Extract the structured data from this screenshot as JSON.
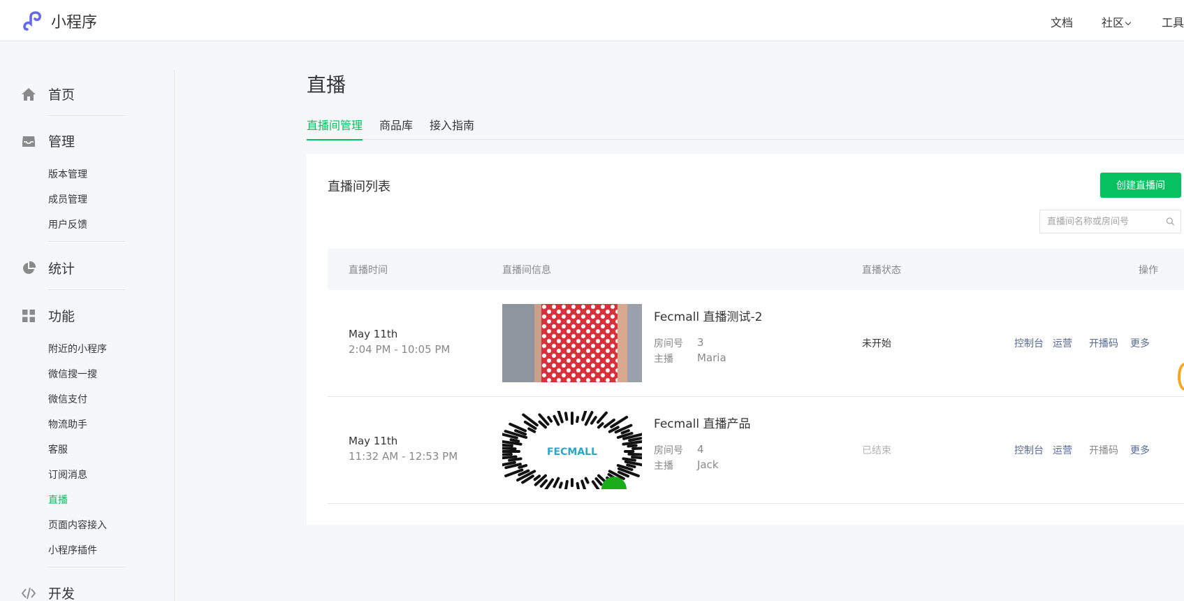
{
  "header": {
    "brand": "小程序",
    "nav": {
      "docs": "文档",
      "community": "社区",
      "tools": "工具"
    }
  },
  "sidebar": {
    "groups": {
      "home": "首页",
      "manage": "管理",
      "stats": "统计",
      "features": "功能",
      "dev": "开发"
    },
    "manage_items": [
      "版本管理",
      "成员管理",
      "用户反馈"
    ],
    "feature_items": [
      "附近的小程序",
      "微信搜一搜",
      "微信支付",
      "物流助手",
      "客服",
      "订阅消息",
      "直播",
      "页面内容接入",
      "小程序插件"
    ],
    "active_item": "直播"
  },
  "page": {
    "title": "直播",
    "tabs": [
      "直播间管理",
      "商品库",
      "接入指南"
    ],
    "active_tab": "直播间管理"
  },
  "panel": {
    "title": "直播间列表",
    "create_button": "创建直播间",
    "search_placeholder": "直播间名称或房间号",
    "columns": {
      "time": "直播时间",
      "info": "直播间信息",
      "status": "直播状态",
      "actions": "操作"
    },
    "meta_labels": {
      "room_no": "房间号",
      "anchor": "主播"
    },
    "rows": [
      {
        "date": "May 11th",
        "time_range": "2:04 PM - 10:05 PM",
        "name": "Fecmall 直播测试-2",
        "room_no": "3",
        "anchor": "Maria",
        "status": "未开始",
        "status_color": "#353535",
        "thumb": "red-polka-dot-dress-image",
        "actions": [
          "控制台",
          "运营",
          "开播码",
          "更多"
        ]
      },
      {
        "date": "May 11th",
        "time_range": "11:32 AM - 12:53 PM",
        "name": "Fecmall 直播产品",
        "room_no": "4",
        "anchor": "Jack",
        "status": "已结束",
        "status_color": "#b2b2b2",
        "thumb": "fecmall-mini-program-code-image",
        "qr_text": "FECMALL",
        "actions": [
          "控制台",
          "运营",
          "开播码",
          "更多"
        ]
      }
    ]
  },
  "colors": {
    "brand_green": "#07c160",
    "link_blue": "#576b95",
    "logo_purple": "#6467f0"
  }
}
